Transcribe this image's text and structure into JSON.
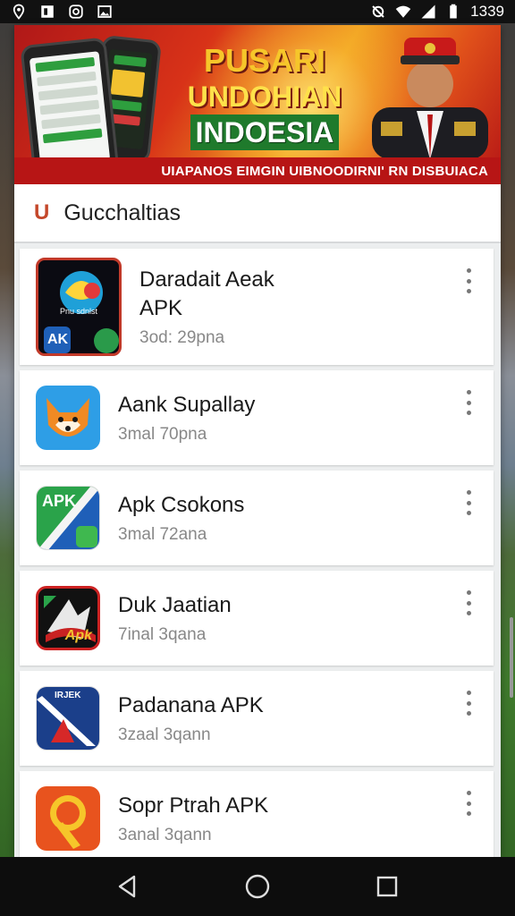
{
  "status_bar": {
    "time": "1339",
    "left_icons": [
      "location-icon",
      "image-icon",
      "instagram-icon",
      "gallery-icon"
    ],
    "right_icons": [
      "sync-icon",
      "wifi-icon",
      "signal-icon",
      "battery-icon"
    ]
  },
  "banner": {
    "title_line1": "PUSARI",
    "title_line2": "UNDOHIAN",
    "title_line3": "INDOESIA",
    "subtitle": "UIAPANOS EIMGIN UIBNOODIRNI' RN DISBUIACA"
  },
  "section": {
    "logo": "U",
    "title": "Gucchaltias"
  },
  "apps": [
    {
      "name_line1": "Daradait Aeak",
      "name_line2": "APK",
      "meta": "3od: 29pna",
      "icon": "app-icon-daradait",
      "icon_top_text": "Pnu sdnlst",
      "icon_bottom_text": "AK"
    },
    {
      "name_line1": "Aank Supallay",
      "name_line2": "",
      "meta": "3mal 70pna",
      "icon": "fox-app-icon"
    },
    {
      "name_line1": "Apk Csokons",
      "name_line2": "",
      "meta": "3mal 72ana",
      "icon": "apk-green-icon",
      "icon_text": "APK"
    },
    {
      "name_line1": "Duk Jaatian",
      "name_line2": "",
      "meta": "7inal 3qana",
      "icon": "duk-app-icon",
      "icon_text": "Apk"
    },
    {
      "name_line1": "Padanana APK",
      "name_line2": "",
      "meta": "3zaal 3qann",
      "icon": "padanana-app-icon",
      "icon_text": "IRJEK"
    },
    {
      "name_line1": "Sopr Ptrah APK",
      "name_line2": "",
      "meta": "3anal 3qann",
      "icon": "sopr-app-icon"
    }
  ],
  "nav": [
    "back-icon",
    "home-icon",
    "recents-icon"
  ],
  "colors": {
    "banner_red": "#b71515",
    "banner_gold": "#f6c62a",
    "accent_logo": "#c4472a"
  }
}
